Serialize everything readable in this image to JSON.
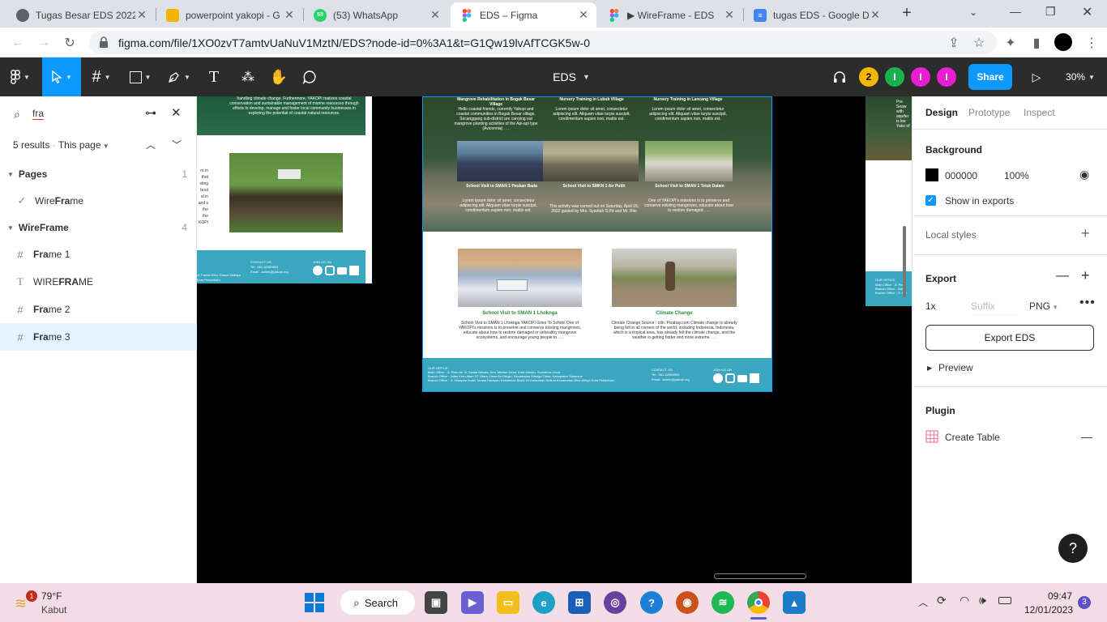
{
  "browser": {
    "tabs": [
      {
        "title": "Tugas Besar EDS 2022",
        "fav_color": "#5f6368",
        "active": false
      },
      {
        "title": "powerpoint yakopi - G",
        "fav_color": "#f4b400",
        "active": false
      },
      {
        "title": "(53) WhatsApp",
        "fav_color": "#25d366",
        "badge": "53",
        "active": false
      },
      {
        "title": "EDS – Figma",
        "fav_color": "#f24e1e",
        "active": true
      },
      {
        "title": "▶ WireFrame - EDS",
        "fav_color": "#f24e1e",
        "active": false
      },
      {
        "title": "tugas EDS - Google D",
        "fav_color": "#4285f4",
        "active": false
      }
    ],
    "url": "figma.com/file/1XO0zvT7amtvUaNuV1MztN/EDS?node-id=0%3A1&t=G1Qw19lvAfTCGK5w-0"
  },
  "figma": {
    "file_name": "EDS",
    "zoom": "30%",
    "share_label": "Share",
    "avatars": [
      {
        "label": "2",
        "color": "#f5b600"
      },
      {
        "label": "I",
        "color": "#1bb14c"
      },
      {
        "label": "I",
        "color": "#e91ed1"
      },
      {
        "label": "I",
        "color": "#e91ed1"
      }
    ]
  },
  "left_panel": {
    "search_value": "fra",
    "results": "5 results",
    "scope": "This page",
    "pages_label": "Pages",
    "pages_count": "1",
    "page_item_pre": "Wire",
    "page_item_hl": "Fra",
    "page_item_post": "me",
    "wireframe_label": "WireFrame",
    "wireframe_count": "4",
    "items": [
      {
        "pre": "",
        "hl": "Fra",
        "post": "me 1",
        "icon": "frame"
      },
      {
        "pre": "WIRE",
        "hl": "FRA",
        "post": "ME",
        "icon": "text"
      },
      {
        "pre": "",
        "hl": "Fra",
        "post": "me 2",
        "icon": "frame"
      },
      {
        "pre": "",
        "hl": "Fra",
        "post": "me 3",
        "icon": "frame",
        "selected": true
      }
    ]
  },
  "canvas": {
    "left_frame": {
      "text": "handling climate change. Furthermore, YAKOPI realizes coastal conservation and sustainable management of marine resources through efforts to develop, manage and foster local community businesses in exploring the potential of coastal natural resources.",
      "contact_title": "CONTACT US",
      "contact_tel": "Tel : 061-42083903",
      "contact_email": "Email : admin@yakopi.org",
      "join": "JOIN US ON",
      "footer_small": "Jl. Pantai Ketu, Dusun Waldya Kota Pekanbaru"
    },
    "main_frame": {
      "top_titles": [
        "Mangrove Rehabilitation in Bogak Besar Village",
        "Nursery Training in Lubuk Village",
        "Nursery Training in Lancang Village"
      ],
      "top_texts": [
        "Hello coastal friends, currently Yakopi and coastal communities in Bogak Besar village, Secanggang sub-district are carrying out mangrove planting activities of the Api-api type (Avicennia) . . .",
        "Lorem ipsum dolor sit amet, consectetur adipiscing elit. Aliquam vitae turpis suscipit, condimentum sapien non, mattis est.",
        "Lorem ipsum dolor sit amet, consectetur adipiscing elit. Aliquam vitae turpis suscipit, condimentum sapien non, mattis est."
      ],
      "mid_titles": [
        "School Visit to SMAN 1 Peukan Bada",
        "School Visit to SMKN 1 Air Putih",
        "School Visit to SMAN 1 Teluk Dalam"
      ],
      "mid_texts": [
        "Lorem ipsum dolor sit amet, consectetur adipiscing elit. Aliquam vitae turpis suscipit, condimentum sapien non, mattis est.",
        "This activity was carried out on Saturday, April 16, 2022 guided by Mrs. Syarifah S.Pd and Mr. Rito",
        "One of YAKOPI's missions is to preserve and conserve existing mangroves, educate about how to restore damaged . . ."
      ],
      "card1_title": "School Visit to SMAN 1 Lhoknga",
      "card1_text": "School Visit to SMAN 1 Lhoknga YAKOPI Goes To School One of YAKOPI's missions is to preserve and conserve existing mangroves, educate about how to restore damaged or unhealthy mangrove ecosystems, and encourage young people to . . .",
      "card2_title": "Climate Change",
      "card2_text": "Climate Change Source : cdn. Pixabay.com Climate change is already being felt in all corners of the world, including Indonesia. Indonesia, which is a tropical area, has already felt the climate change, and the weather is getting hotter and more extreme . . .",
      "footer_office": "OUR OFFICE",
      "footer_main": "Main Office : Jl. Pintu Air IV, Kwala Bekala, Kec. Medan Johor, Kota Medan, Sumatera Utara",
      "footer_branch1": "Branch Office : Jalan Keru Akan RT Utara, Desa Air Dingin, Kecamatan Sibolga Timur, Kabupaten Simeulue",
      "footer_branch2": "Branch Office : Jl. Harapan Indah Taman Harapan Residence Block 94 Kelurahan Delima Kecamatan Bina Widya Kota Pekanbaru",
      "contact_title": "CONTACT US",
      "contact_tel": "Tel : 061-42083903",
      "contact_email": "Email : admin@yakopi.org",
      "join": "JOIN US ON"
    },
    "right_frame": {
      "text": "Pre Seaw with aquifer is lee Yako of",
      "office": "OUR OFFICE",
      "office_lines": "Main Office : Jl. Pintu Branch Office : Jalan Branch Office : Jl. Har"
    }
  },
  "right_panel": {
    "tabs": [
      "Design",
      "Prototype",
      "Inspect"
    ],
    "background_label": "Background",
    "bg_hex": "000000",
    "bg_opacity": "100%",
    "show_in_exports": "Show in exports",
    "local_styles": "Local styles",
    "export_label": "Export",
    "scale": "1x",
    "suffix_placeholder": "Suffix",
    "format": "PNG",
    "export_button": "Export EDS",
    "preview": "Preview",
    "plugin_label": "Plugin",
    "plugin_item": "Create Table",
    "help": "?"
  },
  "taskbar": {
    "weather_temp": "79°F",
    "weather_desc": "Kabut",
    "weather_badge": "1",
    "search": "Search",
    "time": "09:47",
    "date": "12/01/2023",
    "notif": "3"
  }
}
